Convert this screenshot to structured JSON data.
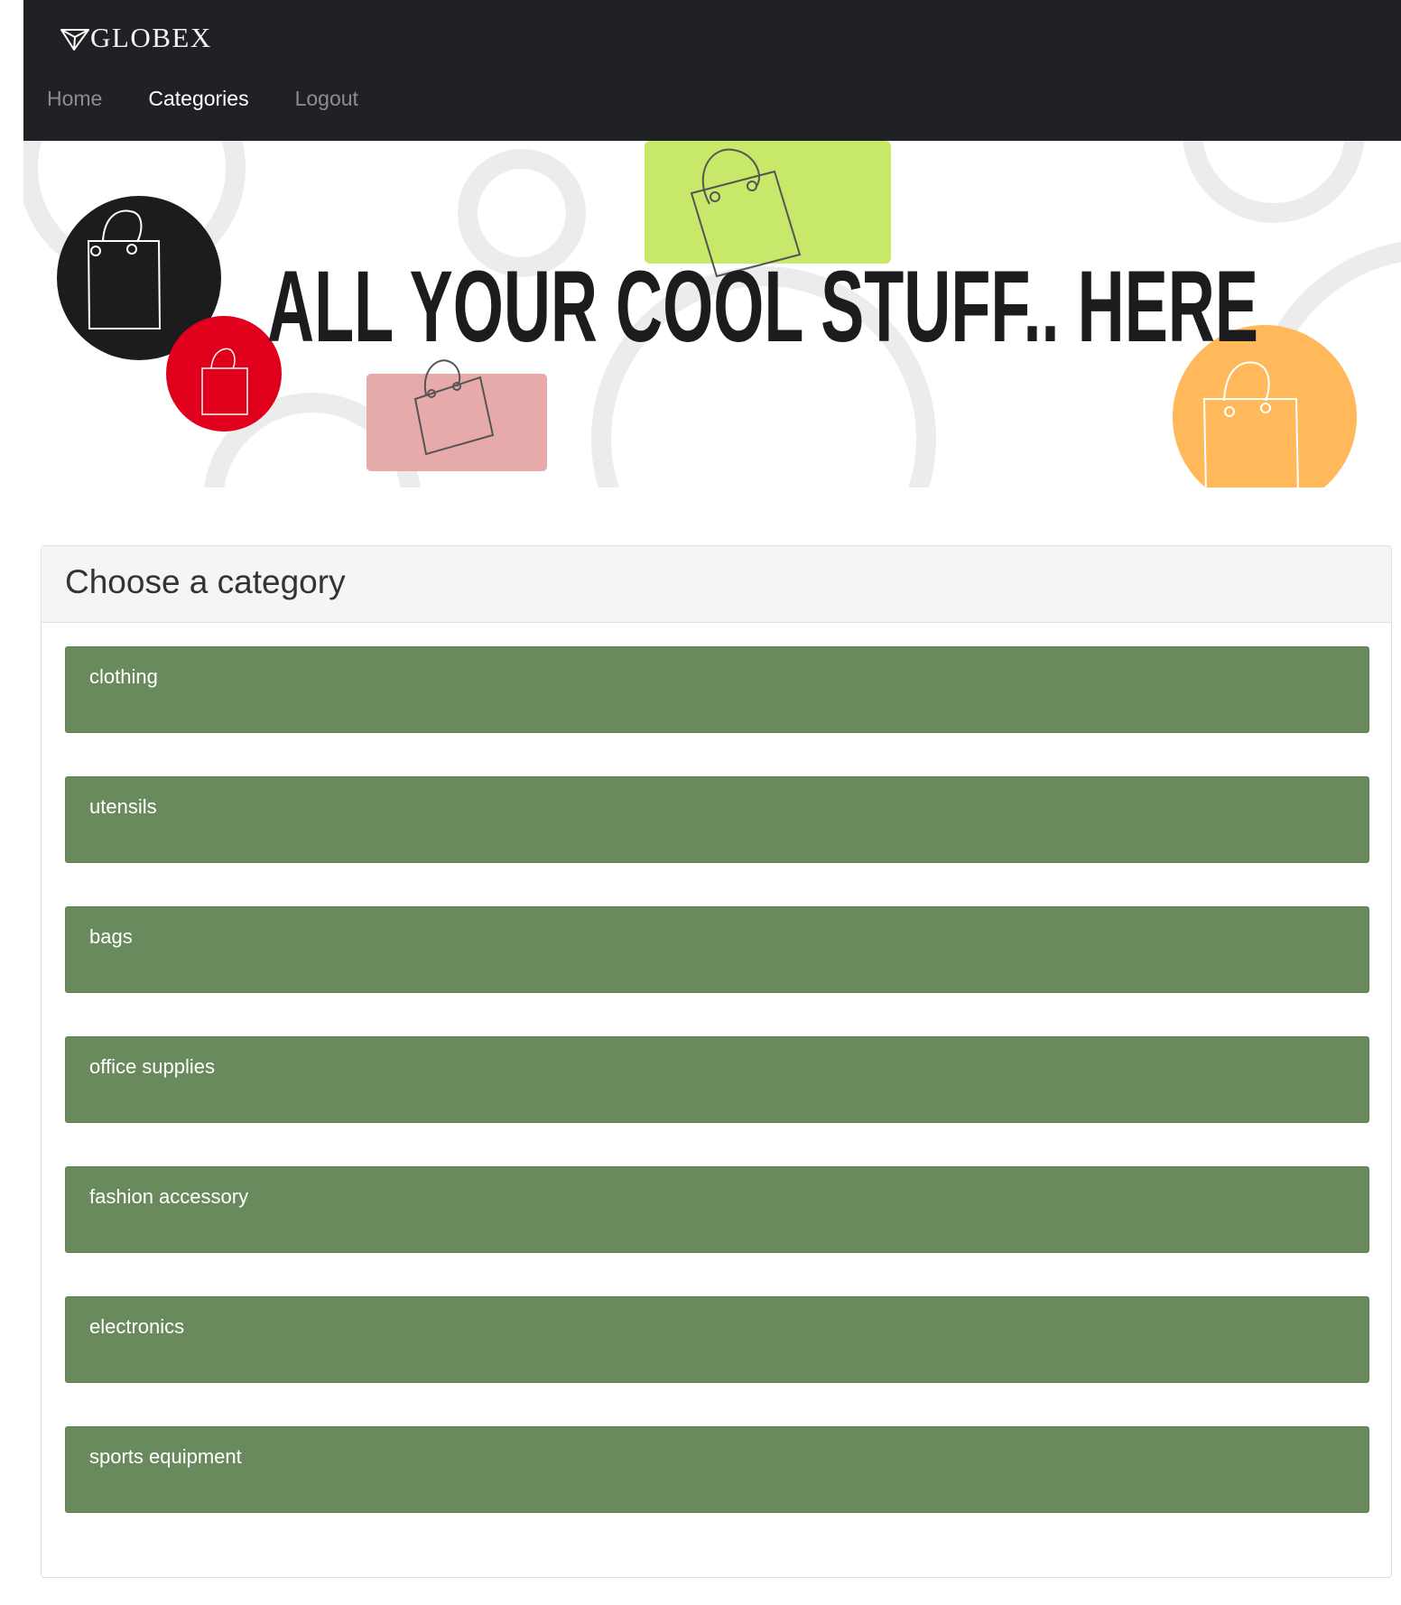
{
  "brand": {
    "name": "GLOBEX",
    "icon": "paper-plane-icon"
  },
  "nav": [
    {
      "label": "Home",
      "active": false
    },
    {
      "label": "Categories",
      "active": true
    },
    {
      "label": "Logout",
      "active": false
    }
  ],
  "banner": {
    "headline": "ALL YOUR COOL STUFF.. HERE",
    "colors": {
      "black": "#1c1c1e",
      "red": "#e0001b",
      "green": "#c8e86a",
      "pink": "#e6aaaa",
      "orange": "#ffb95a",
      "ring": "#ececec"
    }
  },
  "panel": {
    "title": "Choose a category"
  },
  "categories": [
    {
      "label": "clothing"
    },
    {
      "label": "utensils"
    },
    {
      "label": "bags"
    },
    {
      "label": "office supplies"
    },
    {
      "label": "fashion accessory"
    },
    {
      "label": "electronics"
    },
    {
      "label": "sports equipment"
    }
  ],
  "colors": {
    "navbar": "#1f2124",
    "category_bg": "#698a5c",
    "panel_heading_bg": "#f5f5f5"
  }
}
